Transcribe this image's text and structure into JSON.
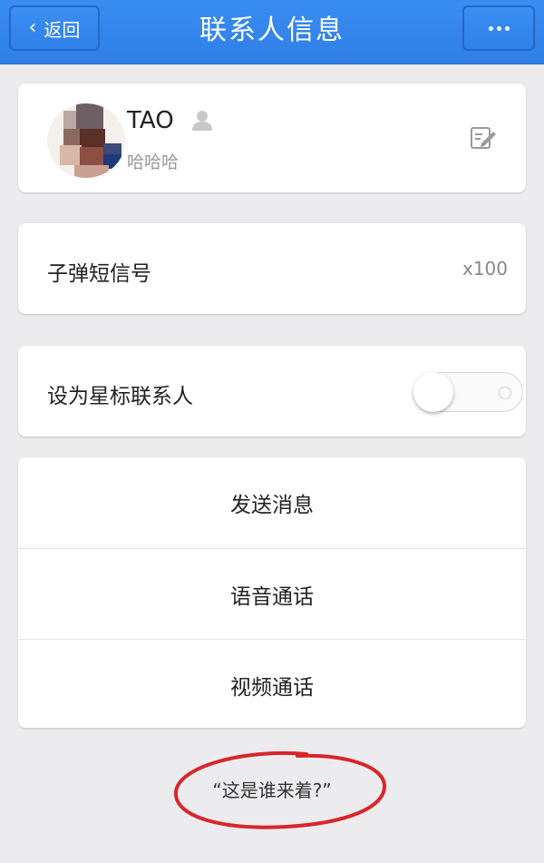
{
  "nav": {
    "back_label": "返回",
    "title": "联系人信息",
    "back_icon": "chevron-left-icon",
    "more_icon": "more-dots-icon"
  },
  "profile": {
    "name": "TAO",
    "remark": "哈哈哈",
    "person_icon": "person-icon",
    "edit_icon": "edit-icon"
  },
  "bullet_sms": {
    "label": "子弹短信号",
    "value": "x100"
  },
  "star_contact": {
    "label": "设为星标联系人",
    "enabled": false
  },
  "actions": [
    "发送消息",
    "语音通话",
    "视频通话"
  ],
  "annotation": "“这是谁来着?”",
  "colors": {
    "nav_bar": "#2f80e8",
    "background": "#ececee",
    "annotation_circle": "#d8262a"
  }
}
